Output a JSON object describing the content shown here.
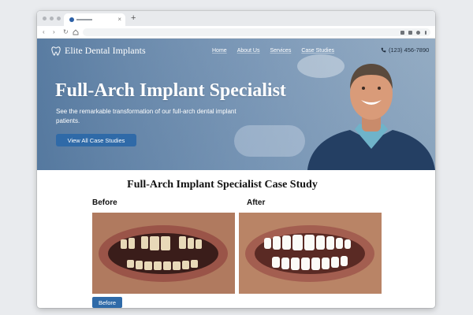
{
  "site": {
    "logo_text": "Elite Dental Implants",
    "nav": [
      "Home",
      "About Us",
      "Services",
      "Case Studies"
    ],
    "phone": "(123) 456-7890"
  },
  "hero": {
    "title": "Full-Arch Implant Specialist",
    "subtitle": "See the remarkable transformation of our full-arch dental implant patients.",
    "cta_label": "View All Case Studies"
  },
  "case_study": {
    "title": "Full-Arch Implant Specialist Case Study",
    "before_label": "Before",
    "after_label": "After",
    "toggle_label": "Before"
  },
  "browser": {
    "new_tab": "+",
    "close_tab": "×",
    "back": "‹",
    "forward": "›",
    "reload": "↻"
  },
  "colors": {
    "brand_blue": "#2f6aa8",
    "hero_overlay": "#345e8c",
    "scrub_navy": "#243f63"
  },
  "icons": [
    "tooth-icon",
    "phone-icon",
    "back-icon",
    "forward-icon",
    "reload-icon",
    "home-icon",
    "extension-icon",
    "profile-icon",
    "menu-icon"
  ]
}
